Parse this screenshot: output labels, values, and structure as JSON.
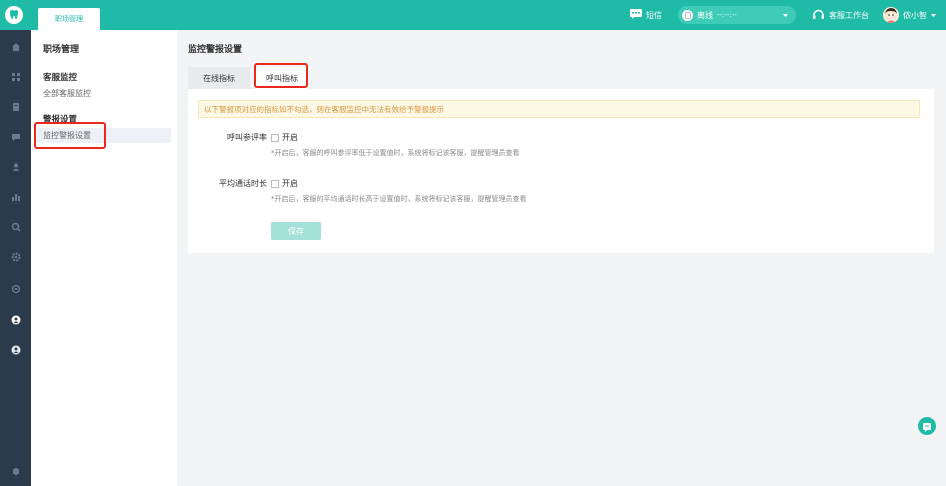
{
  "topbar": {
    "tab_label": "职场管理",
    "sms_label": "短信",
    "status_label": "离线",
    "status_timer": "--:--:--",
    "workbench_label": "客服工作台",
    "user_name": "侬小智"
  },
  "sidebar": {
    "title": "职场管理",
    "groups": [
      {
        "label": "客服监控",
        "items": [
          {
            "label": "全部客服监控"
          }
        ]
      },
      {
        "label": "警报设置",
        "items": [
          {
            "label": "监控警报设置"
          }
        ]
      }
    ]
  },
  "main": {
    "title": "监控警报设置",
    "tabs": [
      {
        "label": "在线指标"
      },
      {
        "label": "呼叫指标"
      }
    ],
    "notice": "以下警报项对应的指标如不勾选，则在客服监控中无法有效给予警报提示",
    "settings": [
      {
        "label": "呼叫参评率",
        "checkbox_label": "开启",
        "hint": "*开启后，客服的呼叫参评率低于设置值时，系统将标记该客服，提醒管理员查看"
      },
      {
        "label": "平均通话时长",
        "checkbox_label": "开启",
        "hint": "*开启后，客服的平均通话时长高于设置值时，系统将标记该客服，提醒管理员查看"
      }
    ],
    "save_label": "保存"
  },
  "colors": {
    "brand": "#1fbba6",
    "nav_dark": "#2c3b4c",
    "highlight_red": "#e8291c",
    "notice_text": "#d8963b"
  },
  "icons": [
    "logo-icon",
    "home-icon",
    "grid-icon",
    "document-icon",
    "chat-icon",
    "user-icon",
    "bar-chart-icon",
    "search-icon",
    "settings-icon",
    "layers-icon",
    "monitor-icon",
    "account-icon",
    "bell-icon",
    "message-icon",
    "headset-icon",
    "help-icon"
  ]
}
